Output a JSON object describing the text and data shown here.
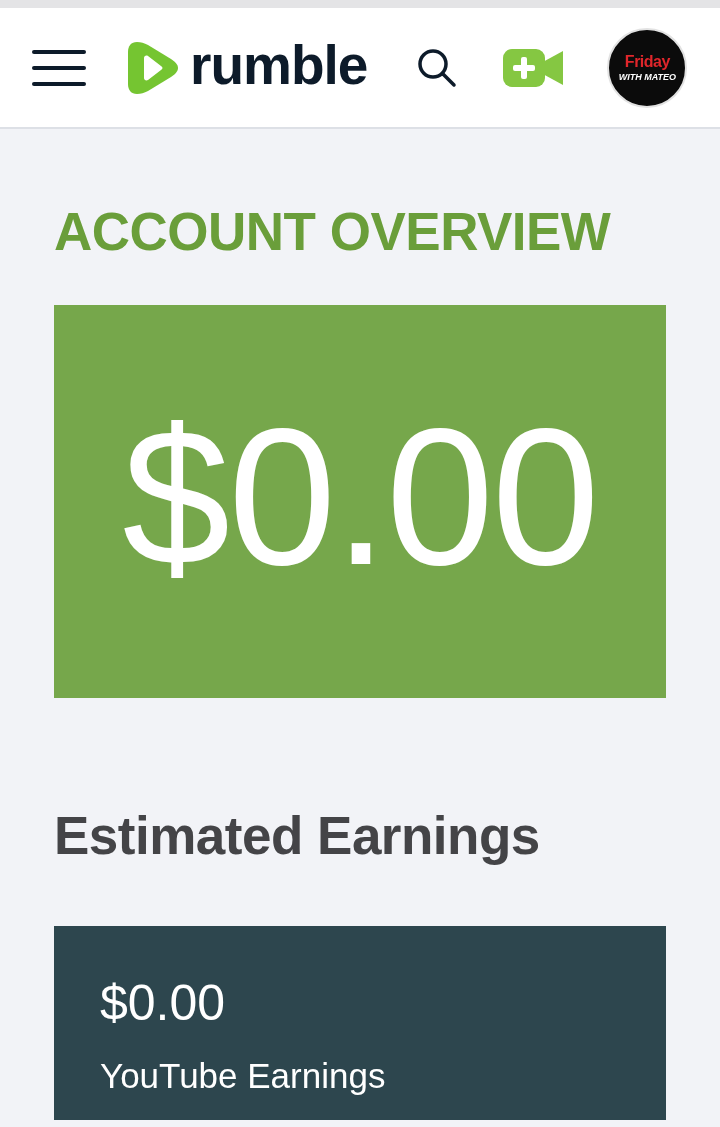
{
  "header": {
    "logo_text": "rumble",
    "avatar": {
      "title": "Friday",
      "subtitle": "WITH MATEO"
    }
  },
  "overview": {
    "title": "ACCOUNT OVERVIEW",
    "balance": "$0.00"
  },
  "estimated_earnings": {
    "title": "Estimated Earnings",
    "cards": [
      {
        "amount": "$0.00",
        "label": "YouTube Earnings"
      }
    ]
  }
}
